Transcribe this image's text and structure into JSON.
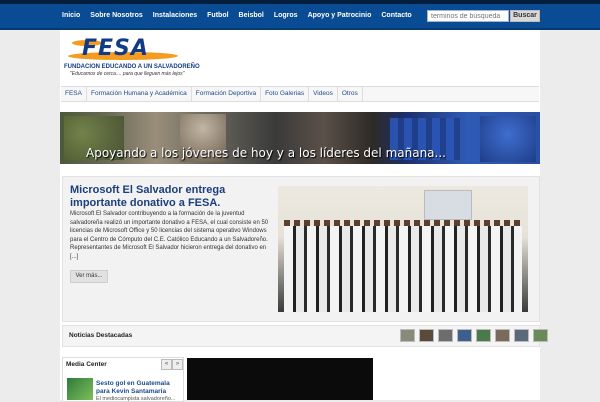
{
  "nav": {
    "items": [
      "Inicio",
      "Sobre Nosotros",
      "Instalaciones",
      "Futbol",
      "Beisbol",
      "Logros",
      "Apoyo y Patrocinio",
      "Contacto"
    ],
    "search_placeholder": "terminos de búsqueda",
    "search_button": "Buscar"
  },
  "logo": {
    "brand": "FESA",
    "subtitle": "FUNDACION EDUCANDO A UN SALVADOREÑO",
    "slogan": "\"Educamos de cerca.... para que lleguen más lejos\""
  },
  "subnav": {
    "items": [
      "FESA",
      "Formación Humana y Académica",
      "Formación Deportiva",
      "Foto Galerias",
      "Videos",
      "Otros"
    ]
  },
  "banner": {
    "tagline": "Apoyando a los jóvenes de hoy y a los líderes del mañana..."
  },
  "feature": {
    "title": "Microsoft El Salvador entrega importante donativo a FESA.",
    "body": "Microsoft El Salvador contribuyendo a la formación de la juventud salvadoreña realizó un importante donativo a FESA, el cual consiste en 50 licencias de Microsoft Office y 50 licencias del sistema operativo Windows para el Centro de Cómputo del C.E. Católico Educando a un Salvadoreño. Representantes de Microsoft El Salvador hicieron entrega del donativo en [...]",
    "more_label": "Ver más..."
  },
  "news": {
    "label": "Noticias Destacadas",
    "thumb_colors": [
      "#8a8a7a",
      "#5a4a3a",
      "#6d6d6d",
      "#3e5e8e",
      "#4a7a4a",
      "#7a6a5a",
      "#5a6a7a",
      "#6a8a5a"
    ]
  },
  "media": {
    "title": "Media Center",
    "prev": "«",
    "next": "»",
    "item_title": "Sesto gol en Guatemala para Kevin Santamaría",
    "item_desc": "El mediocampista salvadoreño..."
  }
}
